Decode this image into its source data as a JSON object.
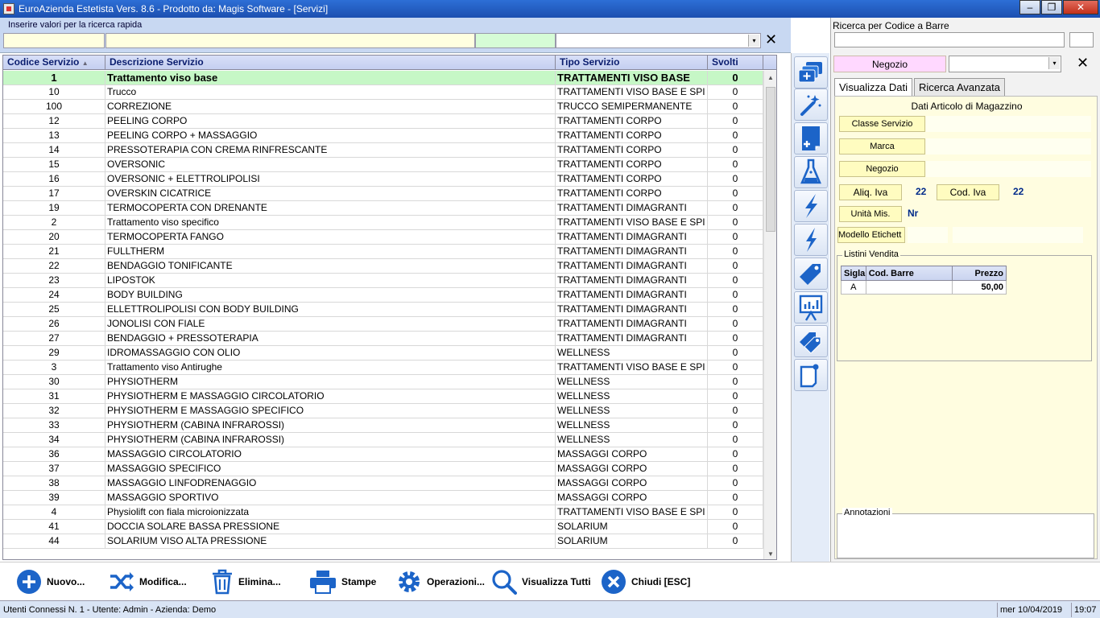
{
  "window": {
    "title": "EuroAzienda Estetista Vers. 8.6 - Prodotto da: Magis Software - [Servizi]",
    "min": "–",
    "max": "❐",
    "close": "✕"
  },
  "quick_search": {
    "label": "Inserire valori per la ricerca rapida",
    "clear": "✕",
    "dropdown_arrow": "▾"
  },
  "grid": {
    "columns": [
      "Codice Servizio",
      "Descrizione Servizio",
      "Tipo Servizio",
      "Svolti"
    ],
    "sort_indicator": "▲",
    "rows": [
      {
        "code": "1",
        "desc": "Trattamento viso base",
        "type": "TRATTAMENTI  VISO BASE",
        "done": "0"
      },
      {
        "code": "10",
        "desc": "Trucco",
        "type": "TRATTAMENTI  VISO BASE E SPI",
        "done": "0"
      },
      {
        "code": "100",
        "desc": "CORREZIONE",
        "type": "TRUCCO SEMIPERMANENTE",
        "done": "0"
      },
      {
        "code": "12",
        "desc": "PEELING CORPO",
        "type": "TRATTAMENTI CORPO",
        "done": "0"
      },
      {
        "code": "13",
        "desc": "PEELING CORPO + MASSAGGIO",
        "type": "TRATTAMENTI CORPO",
        "done": "0"
      },
      {
        "code": "14",
        "desc": "PRESSOTERAPIA CON CREMA RINFRESCANTE",
        "type": "TRATTAMENTI CORPO",
        "done": "0"
      },
      {
        "code": "15",
        "desc": "OVERSONIC",
        "type": "TRATTAMENTI CORPO",
        "done": "0"
      },
      {
        "code": "16",
        "desc": "OVERSONIC + ELETTROLIPOLISI",
        "type": "TRATTAMENTI CORPO",
        "done": "0"
      },
      {
        "code": "17",
        "desc": "OVERSKIN CICATRICE",
        "type": "TRATTAMENTI CORPO",
        "done": "0"
      },
      {
        "code": "19",
        "desc": "TERMOCOPERTA CON DRENANTE",
        "type": "TRATTAMENTI DIMAGRANTI",
        "done": "0"
      },
      {
        "code": "2",
        "desc": "Trattamento viso specifico",
        "type": "TRATTAMENTI  VISO BASE E SPI",
        "done": "0"
      },
      {
        "code": "20",
        "desc": "TERMOCOPERTA FANGO",
        "type": "TRATTAMENTI DIMAGRANTI",
        "done": "0"
      },
      {
        "code": "21",
        "desc": "FULLTHERM",
        "type": "TRATTAMENTI DIMAGRANTI",
        "done": "0"
      },
      {
        "code": "22",
        "desc": "BENDAGGIO TONIFICANTE",
        "type": "TRATTAMENTI DIMAGRANTI",
        "done": "0"
      },
      {
        "code": "23",
        "desc": "LIPOSTOK",
        "type": "TRATTAMENTI DIMAGRANTI",
        "done": "0"
      },
      {
        "code": "24",
        "desc": "BODY BUILDING",
        "type": "TRATTAMENTI DIMAGRANTI",
        "done": "0"
      },
      {
        "code": "25",
        "desc": "ELLETTROLIPOLISI CON BODY BUILDING",
        "type": "TRATTAMENTI DIMAGRANTI",
        "done": "0"
      },
      {
        "code": "26",
        "desc": "JONOLISI CON FIALE",
        "type": "TRATTAMENTI DIMAGRANTI",
        "done": "0"
      },
      {
        "code": "27",
        "desc": "BENDAGGIO + PRESSOTERAPIA",
        "type": "TRATTAMENTI DIMAGRANTI",
        "done": "0"
      },
      {
        "code": "29",
        "desc": "IDROMASSAGGIO CON OLIO",
        "type": "WELLNESS",
        "done": "0"
      },
      {
        "code": "3",
        "desc": "Trattamento viso Antirughe",
        "type": "TRATTAMENTI  VISO BASE E SPI",
        "done": "0"
      },
      {
        "code": "30",
        "desc": "PHYSIOTHERM",
        "type": "WELLNESS",
        "done": "0"
      },
      {
        "code": "31",
        "desc": "PHYSIOTHERM E MASSAGGIO CIRCOLATORIO",
        "type": "WELLNESS",
        "done": "0"
      },
      {
        "code": "32",
        "desc": "PHYSIOTHERM E MASSAGGIO SPECIFICO",
        "type": "WELLNESS",
        "done": "0"
      },
      {
        "code": "33",
        "desc": "PHYSIOTHERM (CABINA INFRAROSSI)",
        "type": "WELLNESS",
        "done": "0"
      },
      {
        "code": "34",
        "desc": "PHYSIOTHERM (CABINA INFRAROSSI)",
        "type": "WELLNESS",
        "done": "0"
      },
      {
        "code": "36",
        "desc": "MASSAGGIO CIRCOLATORIO",
        "type": "MASSAGGI CORPO",
        "done": "0"
      },
      {
        "code": "37",
        "desc": "MASSAGGIO SPECIFICO",
        "type": "MASSAGGI CORPO",
        "done": "0"
      },
      {
        "code": "38",
        "desc": "MASSAGGIO LINFODRENAGGIO",
        "type": "MASSAGGI CORPO",
        "done": "0"
      },
      {
        "code": "39",
        "desc": "MASSAGGIO SPORTIVO",
        "type": "MASSAGGI CORPO",
        "done": "0"
      },
      {
        "code": "4",
        "desc": "Physiolift con fiala microionizzata",
        "type": "TRATTAMENTI  VISO BASE E SPI",
        "done": "0"
      },
      {
        "code": "41",
        "desc": "DOCCIA SOLARE BASSA PRESSIONE",
        "type": "SOLARIUM",
        "done": "0"
      },
      {
        "code": "44",
        "desc": "SOLARIUM VISO ALTA PRESSIONE",
        "type": "SOLARIUM",
        "done": "0"
      }
    ]
  },
  "right": {
    "barcode_label": "Ricerca per Codice a Barre",
    "negozio_button": "Negozio",
    "clear": "✕",
    "dropdown_arrow": "▾",
    "tabs": [
      "Visualizza Dati",
      "Ricerca Avanzata"
    ],
    "section_title": "Dati Articolo di Magazzino",
    "fields": {
      "classe_servizio": "Classe Servizio",
      "marca": "Marca",
      "negozio": "Negozio",
      "aliq_iva": "Aliq. Iva",
      "aliq_iva_value": "22",
      "cod_iva": "Cod. Iva",
      "cod_iva_value": "22",
      "unita_mis": "Unità Mis.",
      "unita_mis_value": "Nr",
      "modello_etichetta": "Modello Etichett"
    },
    "listini": {
      "legend": "Listini Vendita",
      "headers": [
        "Sigla",
        "Cod. Barre",
        "Prezzo"
      ],
      "rows": [
        {
          "sigla": "A",
          "cod_barre": "",
          "prezzo": "50,00"
        }
      ]
    },
    "annotazioni": "Annotazioni"
  },
  "actions": {
    "nuovo": "Nuovo...",
    "modifica": "Modifica...",
    "elimina": "Elimina...",
    "stampe": "Stampe",
    "operazioni": "Operazioni...",
    "visualizza_tutti": "Visualizza Tutti",
    "chiudi": "Chiudi [ESC]"
  },
  "status": {
    "text": "Utenti Connessi N. 1 - Utente: Admin - Azienda: Demo",
    "date": "mer 10/04/2019",
    "time": "19:07"
  },
  "colors": {
    "selected_row": "#c6f7c6",
    "header_text": "#0a1d6e",
    "icon_blue": "#1c64c8",
    "negozio_button": "#ffd8ff"
  }
}
